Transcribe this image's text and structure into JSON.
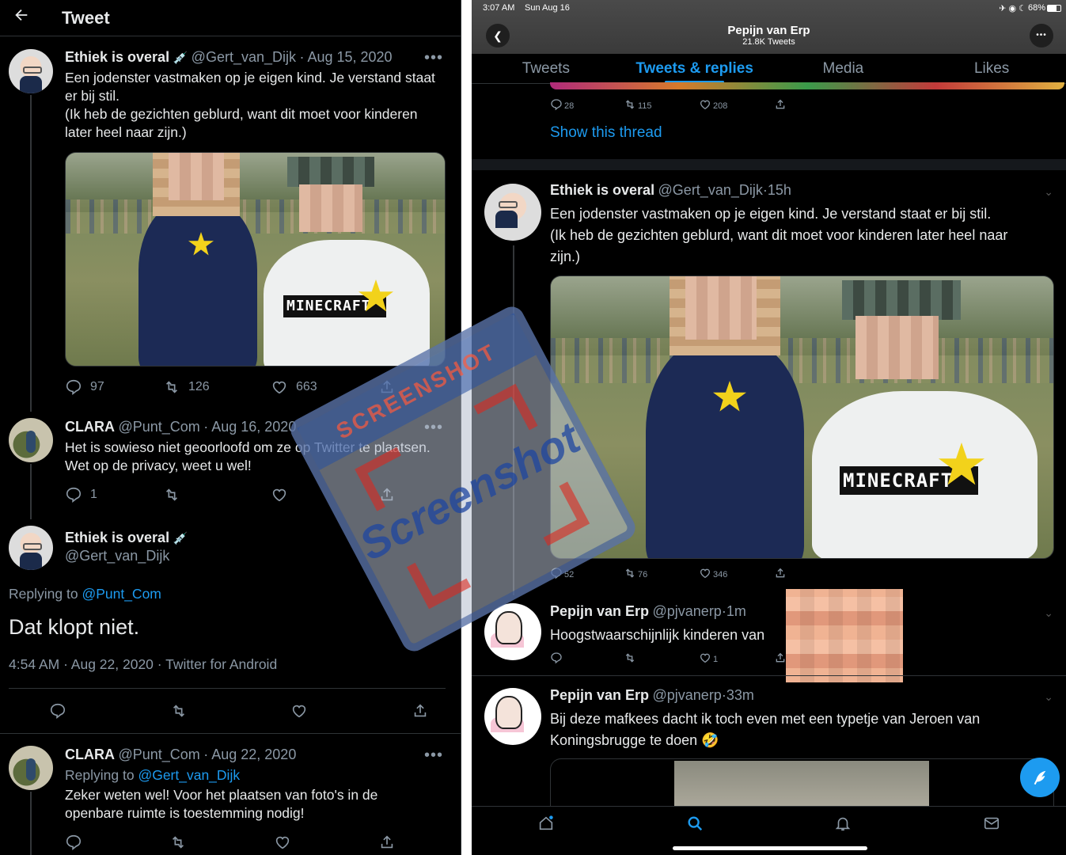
{
  "left": {
    "header": {
      "back_icon": "arrow-left-icon",
      "title": "Tweet"
    },
    "tweets": [
      {
        "name": "Ethiek is overal",
        "badge": "💉",
        "handle": "@Gert_van_Dijk",
        "date": "· Aug 15, 2020",
        "text": [
          "Een jodenster vastmaken op je eigen kind. Je verstand staat",
          "er bij stil.",
          "(Ik heb de gezichten geblurd, want dit moet voor kinderen",
          "later heel naar zijn.)"
        ],
        "image_overlay_text": "MINECRAFT",
        "replies": "97",
        "retweets": "126",
        "likes": "663"
      },
      {
        "name": "CLARA",
        "handle": "@Punt_Com",
        "date": "· Aug 16, 2020",
        "text": [
          "Het is sowieso niet geoorloofd om ze op Twitter te plaatsen.",
          "Wet op de privacy, weet u wel!"
        ],
        "replies": "1"
      }
    ],
    "main": {
      "name": "Ethiek is overal",
      "badge": "💉",
      "handle": "@Gert_van_Dijk",
      "replying_to_label": "Replying to",
      "replying_to_handle": "@Punt_Com",
      "text": "Dat klopt niet.",
      "meta": "4:54 AM · Aug 22, 2020 · Twitter for Android"
    },
    "reply": {
      "name": "CLARA",
      "handle": "@Punt_Com",
      "date": "· Aug 22, 2020",
      "replying_to_label": "Replying to",
      "replying_to_handle": "@Gert_van_Dijk",
      "text": [
        "Zeker weten wel! Voor het plaatsen van foto's in de",
        "openbare ruimte is toestemming nodig!"
      ]
    }
  },
  "watermark": {
    "top": "SCREENSHOT",
    "main": "Screenshot"
  },
  "right": {
    "status": {
      "time": "3:07 AM",
      "date": "Sun Aug 16",
      "battery": "68%"
    },
    "profile": {
      "name": "Pepijn van Erp",
      "tweets_count": "21.8K Tweets"
    },
    "tabs": [
      "Tweets",
      "Tweets & replies",
      "Media",
      "Likes"
    ],
    "active_tab": 1,
    "prev_stats": {
      "replies": "28",
      "retweets": "115",
      "likes": "208"
    },
    "show_thread": "Show this thread",
    "tweet": {
      "name": "Ethiek is overal",
      "handle": "@Gert_van_Dijk",
      "time": "·15h",
      "text": [
        "Een jodenster vastmaken op je eigen kind. Je verstand staat er bij stil.",
        "(Ik heb de gezichten geblurd, want dit moet voor kinderen later heel naar",
        "zijn.)"
      ],
      "image_overlay_text": "MINECRAFT",
      "replies": "52",
      "retweets": "76",
      "likes": "346"
    },
    "reply1": {
      "name": "Pepijn van Erp",
      "handle": "@pjvanerp",
      "time": "·1m",
      "text": "Hoogstwaarschijnlijk kinderen van",
      "likes": "1"
    },
    "reply2": {
      "name": "Pepijn van Erp",
      "handle": "@pjvanerp",
      "time": "·33m",
      "text": [
        "Bij deze mafkees dacht ik toch even met een typetje van Jeroen van",
        "Koningsbrugge te doen 🤣"
      ]
    }
  },
  "colors": {
    "accent": "#1d9bf0",
    "background": "#000000",
    "muted": "#8b98a5"
  }
}
